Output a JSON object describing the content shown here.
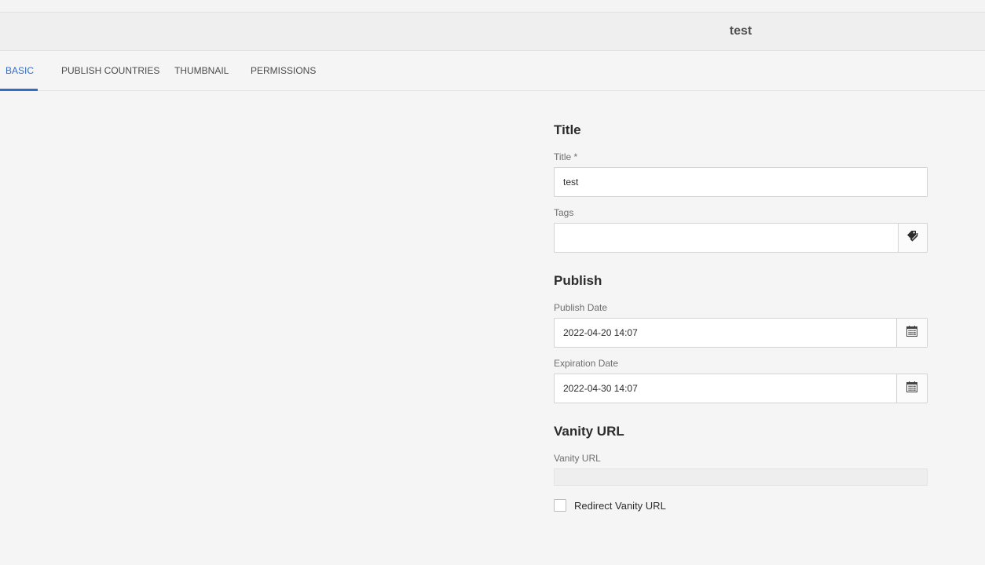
{
  "header": {
    "title": "test"
  },
  "tabs": [
    {
      "label": "BASIC",
      "active": true
    },
    {
      "label": "PUBLISH COUNTRIES",
      "active": false
    },
    {
      "label": "THUMBNAIL",
      "active": false
    },
    {
      "label": "PERMISSIONS",
      "active": false
    }
  ],
  "form": {
    "title_section": {
      "heading": "Title",
      "title_label": "Title *",
      "title_value": "test",
      "tags_label": "Tags",
      "tags_value": "",
      "tags_icon": "tag-icon"
    },
    "publish_section": {
      "heading": "Publish",
      "publish_date_label": "Publish Date",
      "publish_date_value": "2022-04-20 14:07",
      "expiration_date_label": "Expiration Date",
      "expiration_date_value": "2022-04-30 14:07",
      "calendar_icon": "calendar-icon"
    },
    "vanity_section": {
      "heading": "Vanity URL",
      "vanity_url_label": "Vanity URL",
      "vanity_url_value": "",
      "redirect_label": "Redirect Vanity URL",
      "redirect_checked": false
    }
  },
  "colors": {
    "accent": "#326ec8",
    "background": "#f5f5f5"
  }
}
